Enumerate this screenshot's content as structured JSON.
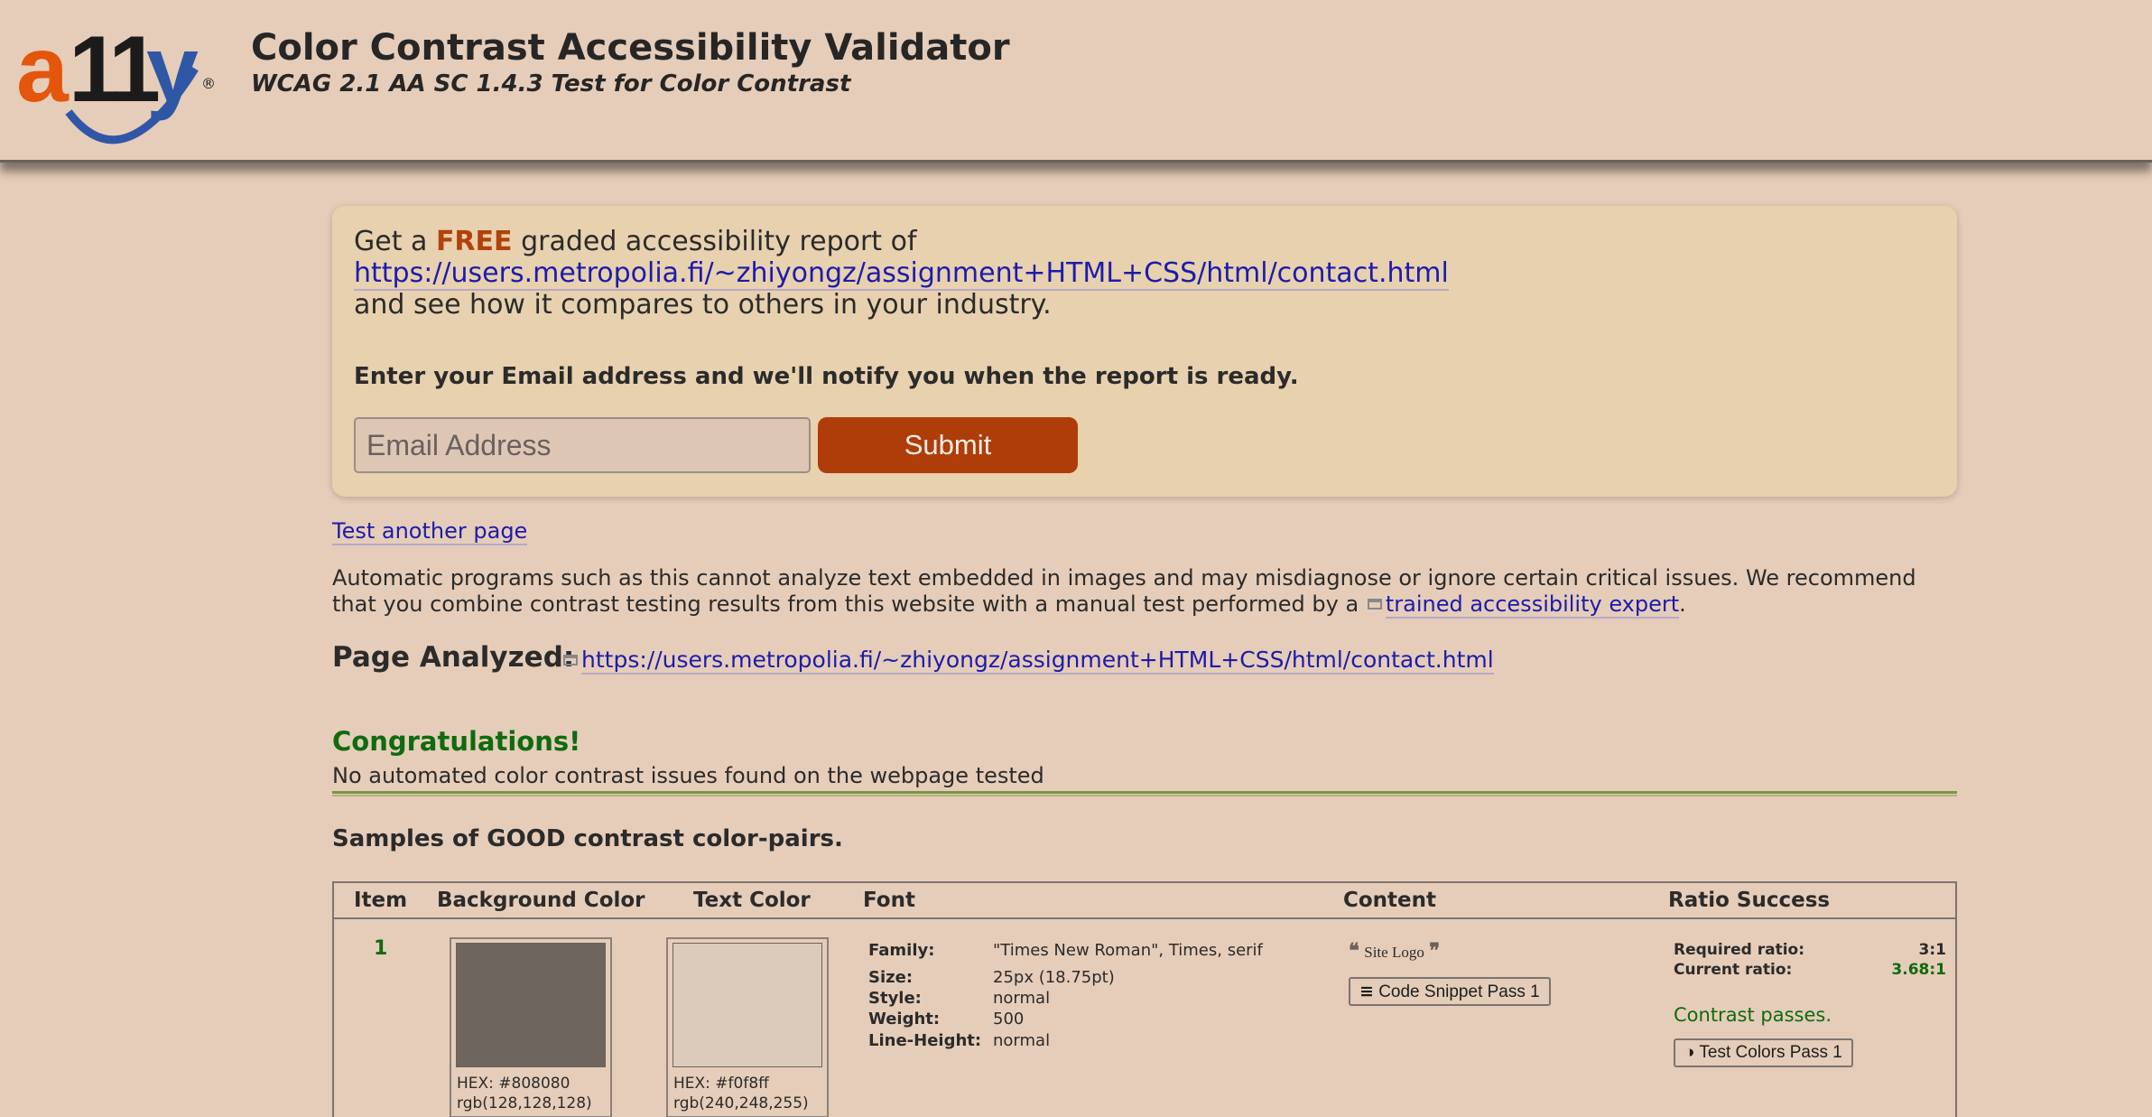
{
  "header": {
    "logo_text": "a11y",
    "title": "Color Contrast Accessibility Validator",
    "subtitle": "WCAG 2.1 AA SC 1.4.3 Test for Color Contrast"
  },
  "promo": {
    "get_a": "Get a",
    "free": "FREE",
    "rest": "graded accessibility report of",
    "url": "https://users.metropolia.fi/~zhiyongz/assignment+HTML+CSS/html/contact.html",
    "compare": "and see how it compares to others in your industry.",
    "email_prompt": "Enter your Email address and we'll notify you when the report is ready.",
    "email_placeholder": "Email Address",
    "submit_label": "Submit"
  },
  "links": {
    "test_another": "Test another page"
  },
  "disclaimer": {
    "text": "Automatic programs such as this cannot analyze text embedded in images and may misdiagnose or ignore certain critical issues. We recommend that you combine contrast testing results from this website with a manual test performed by a",
    "expert_link": "trained accessibility expert",
    "end": "."
  },
  "analyzed": {
    "label": "Page Analyzed:",
    "url": "https://users.metropolia.fi/~zhiyongz/assignment+HTML+CSS/html/contact.html"
  },
  "result": {
    "heading": "Congratulations!",
    "message": "No automated color contrast issues found on the webpage tested"
  },
  "samples": {
    "title": "Samples of GOOD contrast color-pairs.",
    "columns": [
      "Item",
      "Background Color",
      "Text Color",
      "Font",
      "Content",
      "Ratio Success"
    ],
    "rows": [
      {
        "item": "1",
        "bg_hex": "HEX: #808080",
        "bg_rgb": "rgb(128,128,128)",
        "bg_color": "#6e665e",
        "text_hex": "HEX: #f0f8ff",
        "text_rgb": "rgb(240,248,255)",
        "text_color": "#dccbbb",
        "font": {
          "family_label": "Family:",
          "family": "\"Times New Roman\", Times, serif",
          "size_label": "Size:",
          "size": "25px (18.75pt)",
          "style_label": "Style:",
          "style": "normal",
          "weight_label": "Weight:",
          "weight": "500",
          "lineheight_label": "Line-Height:",
          "lineheight": "normal"
        },
        "content_text": "Site Logo",
        "code_snippet_label": "Code Snippet Pass 1",
        "required_label": "Required ratio:",
        "required_value": "3:1",
        "current_label": "Current ratio:",
        "current_value": "3.68:1",
        "status": "Contrast passes.",
        "test_colors_label": "Test Colors Pass 1"
      }
    ]
  },
  "colors": {
    "accent": "#af3d09",
    "success": "#0e6b0e",
    "link": "#1c1caa"
  }
}
